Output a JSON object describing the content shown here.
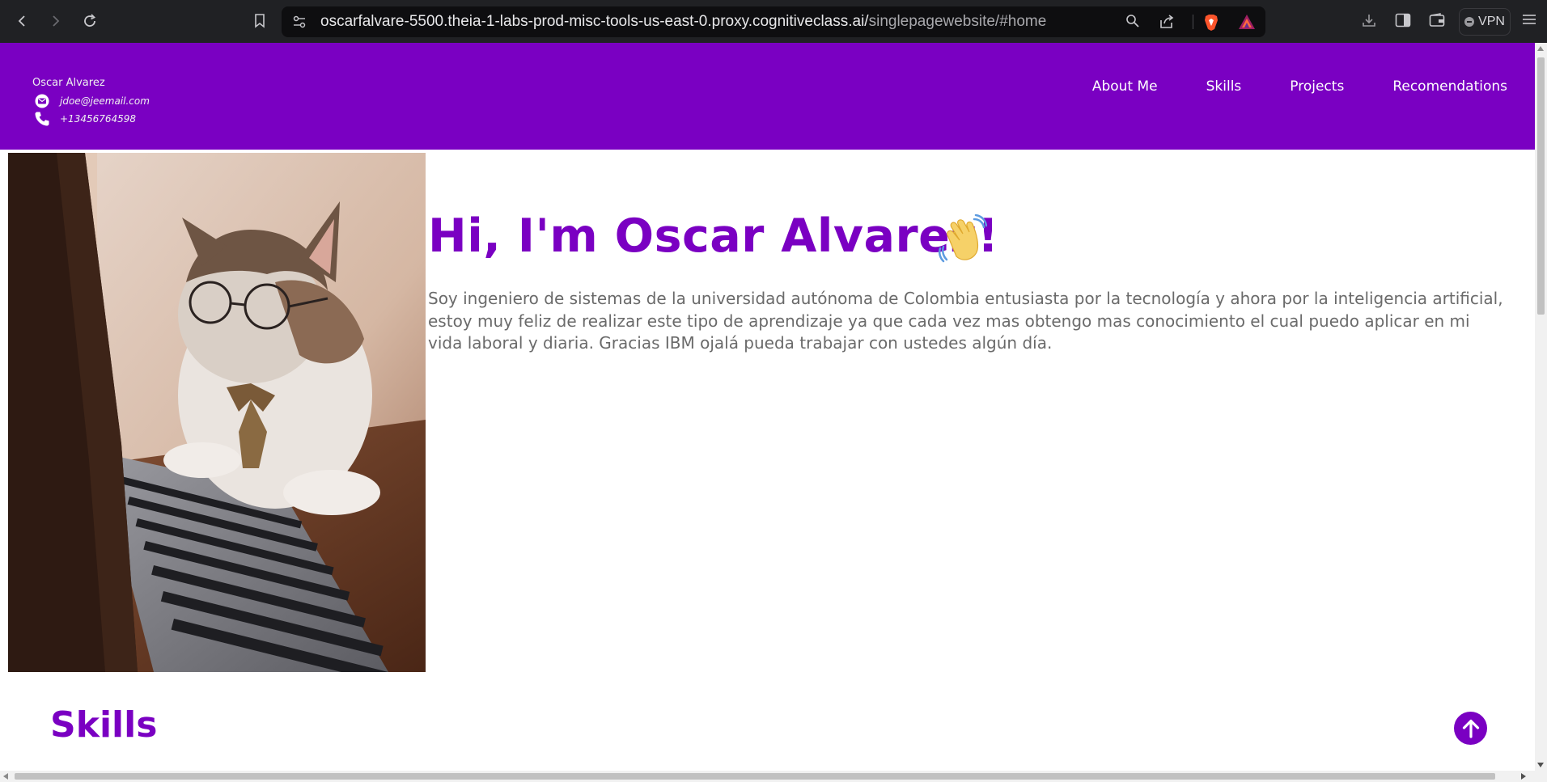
{
  "browser": {
    "url_host": "oscarfalvare-5500.theia-1-labs-prod-misc-tools-us-east-0.proxy.cognitiveclass.ai/",
    "url_path": "singlepagewebsite/#home",
    "vpn_label": "VPN",
    "icons": [
      "back-arrow-icon",
      "forward-arrow-icon",
      "reload-icon",
      "bookmark-icon",
      "site-settings-icon",
      "zoom-icon",
      "share-icon",
      "brave-shields-icon",
      "brave-rewards-icon",
      "download-icon",
      "sidebar-icon",
      "wallet-icon",
      "menu-icon"
    ]
  },
  "header": {
    "name": "Oscar Alvarez",
    "email": "jdoe@jeemail.com",
    "phone": "+13456764598",
    "nav": [
      {
        "label": "About Me"
      },
      {
        "label": "Skills"
      },
      {
        "label": "Projects"
      },
      {
        "label": "Recomendations"
      }
    ]
  },
  "hero": {
    "image_alt": "cat with glasses typing on laptop",
    "title": "Hi, I'm Oscar Alvarez!",
    "wave_icon": "waving-hand-icon",
    "description": "Soy ingeniero de sistemas de la universidad autónoma de Colombia entusiasta por la tecnología y ahora por la inteligencia artificial, estoy muy feliz de realizar este tipo de aprendizaje ya que cada vez mas obtengo mas conocimiento el cual puedo aplicar en mi vida laboral y diaria. Gracias IBM ojalá pueda trabajar con ustedes algún día."
  },
  "skills": {
    "heading": "Skills"
  },
  "colors": {
    "brand_purple": "#7a00c2",
    "browser_bg": "#202124",
    "address_bg": "#0e0e10",
    "body_text": "#6a6a6a"
  }
}
